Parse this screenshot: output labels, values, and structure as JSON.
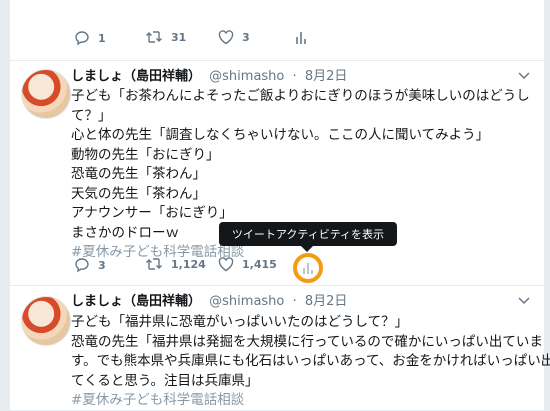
{
  "top_actions": {
    "reply_count": "1",
    "retweet_count": "31",
    "like_count": "3"
  },
  "tweet1": {
    "name": "しましょ（島田祥輔）",
    "handle": "@shimasho",
    "separator": "·",
    "date": "8月2日",
    "lines": [
      "子ども「お茶わんによそったご飯よりおにぎりのほうが美味しいのはどうし",
      "て？」",
      "心と体の先生「調査しなくちゃいけない。ここの人に聞いてみよう」",
      "動物の先生「おにぎり」",
      "恐竜の先生「茶わん」",
      "天気の先生「茶わん」",
      "アナウンサー「おにぎり」",
      "まさかのドローｗ"
    ],
    "hashtag": "#夏休み子ども科学電話相談",
    "reply_count": "3",
    "retweet_count": "1,124",
    "like_count": "1,415"
  },
  "tooltip": "ツイートアクティビティを表示",
  "tweet2": {
    "name": "しましょ（島田祥輔）",
    "handle": "@shimasho",
    "separator": "·",
    "date": "8月2日",
    "lines": [
      "子ども「福井県に恐竜がいっぱいいたのはどうして？」",
      "恐竜の先生「福井県は発掘を大規模に行っているので確かにいっぱい出ていま",
      "す。でも熊本県や兵庫県にも化石はいっぱいあって、お金をかければいっぱい出",
      "てくると思う。注目は兵庫県」"
    ],
    "hashtag": "#夏休み子ども科学電話相談"
  },
  "colors": {
    "accent": "#1da1f2",
    "icon": "#657786",
    "highlight_ring": "#f39c12",
    "tooltip_bg": "#14171a"
  },
  "icons": [
    "reply-icon",
    "retweet-icon",
    "heart-icon",
    "analytics-icon",
    "chevron-down-icon"
  ]
}
